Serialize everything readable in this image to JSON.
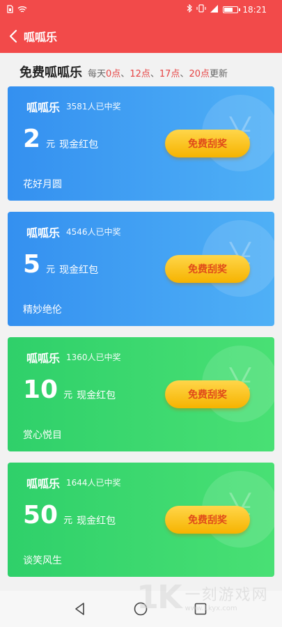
{
  "status_bar": {
    "time": "18:21",
    "left_icons": [
      "sim-icon",
      "wifi-icon"
    ],
    "right_icons": [
      "bluetooth-icon",
      "vibrate-icon",
      "signal-icon",
      "battery-icon"
    ]
  },
  "app_bar": {
    "title": "呱呱乐",
    "back_icon": "chevron-left-icon"
  },
  "section": {
    "title": "免费呱呱乐",
    "subtitle_prefix": "每天",
    "times": [
      "0点",
      "12点",
      "17点",
      "20点"
    ],
    "separator": "、",
    "subtitle_suffix": "更新"
  },
  "cards": [
    {
      "name": "呱呱乐",
      "winners": "3581人已中奖",
      "amount": "2",
      "unit": "元",
      "prize_type": "现金红包",
      "slogan": "花好月圆",
      "button": "免费刮奖",
      "theme": "blue"
    },
    {
      "name": "呱呱乐",
      "winners": "4546人已中奖",
      "amount": "5",
      "unit": "元",
      "prize_type": "现金红包",
      "slogan": "精妙绝伦",
      "button": "免费刮奖",
      "theme": "blue"
    },
    {
      "name": "呱呱乐",
      "winners": "1360人已中奖",
      "amount": "10",
      "unit": "元",
      "prize_type": "现金红包",
      "slogan": "赏心悦目",
      "button": "免费刮奖",
      "theme": "green"
    },
    {
      "name": "呱呱乐",
      "winners": "1644人已中奖",
      "amount": "50",
      "unit": "元",
      "prize_type": "现金红包",
      "slogan": "谈笑风生",
      "button": "免费刮奖",
      "theme": "green"
    }
  ],
  "watermark": {
    "logo_text": "1K",
    "site_name": "一刻游戏网",
    "site_url": "www.1kyx.com"
  },
  "colors": {
    "header": "#f24a4a",
    "blue_card": "#3490f0",
    "green_card": "#2fd06a",
    "button": "#f6b300",
    "button_text": "#e04a1a",
    "highlight": "#e64444"
  },
  "nav_icons": [
    "back-triangle-icon",
    "home-circle-icon",
    "recent-square-icon"
  ]
}
